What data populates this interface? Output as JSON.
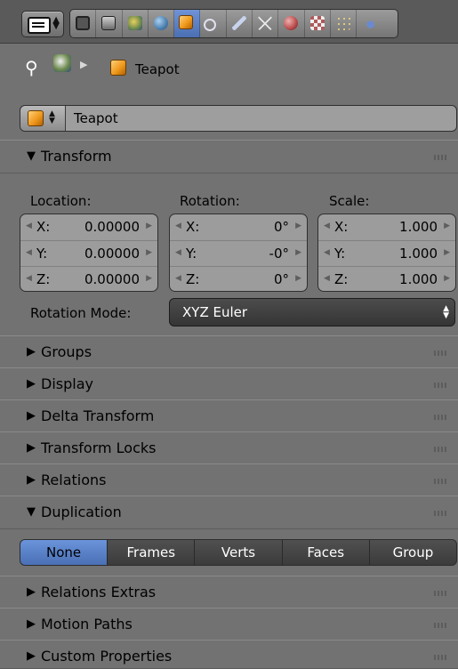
{
  "header": {
    "editor_type_icon": "properties-editor-icon",
    "tabs": [
      {
        "icon": "render-icon",
        "color": "#555555"
      },
      {
        "icon": "render-layers-icon",
        "color": "#6b6b6b"
      },
      {
        "icon": "scene-icon",
        "color": "#6d8a4d"
      },
      {
        "icon": "world-icon",
        "color": "#4a7fae"
      },
      {
        "icon": "object-icon",
        "color": "#f0a030",
        "active": true
      },
      {
        "icon": "constraints-icon",
        "color": "#a0a0c0"
      },
      {
        "icon": "modifiers-icon",
        "color": "#7f93b8"
      },
      {
        "icon": "data-icon",
        "color": "#c8c8c8"
      },
      {
        "icon": "material-icon",
        "color": "#b84a4a"
      },
      {
        "icon": "texture-icon",
        "color": "#b05a5a"
      },
      {
        "icon": "particles-icon",
        "color": "#d8c870"
      },
      {
        "icon": "physics-icon",
        "color": "#6a8ad0"
      }
    ]
  },
  "breadcrumb": {
    "pin_icon": "pin-icon",
    "scene_icon": "scene-icon",
    "object_label": "Teapot"
  },
  "object_name": "Teapot",
  "panels": {
    "transform": {
      "title": "Transform",
      "location_label": "Location:",
      "rotation_label": "Rotation:",
      "scale_label": "Scale:",
      "location": [
        {
          "axis": "X:",
          "value": "0.00000"
        },
        {
          "axis": "Y:",
          "value": "0.00000"
        },
        {
          "axis": "Z:",
          "value": "0.00000"
        }
      ],
      "rotation": [
        {
          "axis": "X:",
          "value": "0°"
        },
        {
          "axis": "Y:",
          "value": "-0°"
        },
        {
          "axis": "Z:",
          "value": "0°"
        }
      ],
      "scale": [
        {
          "axis": "X:",
          "value": "1.000"
        },
        {
          "axis": "Y:",
          "value": "1.000"
        },
        {
          "axis": "Z:",
          "value": "1.000"
        }
      ],
      "rotation_mode_label": "Rotation Mode:",
      "rotation_mode_value": "XYZ Euler"
    },
    "groups": "Groups",
    "display": "Display",
    "delta_transform": "Delta Transform",
    "transform_locks": "Transform Locks",
    "relations": "Relations",
    "duplication": {
      "title": "Duplication",
      "options": [
        "None",
        "Frames",
        "Verts",
        "Faces",
        "Group"
      ],
      "selected": "None"
    },
    "relations_extras": "Relations Extras",
    "motion_paths": "Motion Paths",
    "custom_properties": "Custom Properties"
  }
}
